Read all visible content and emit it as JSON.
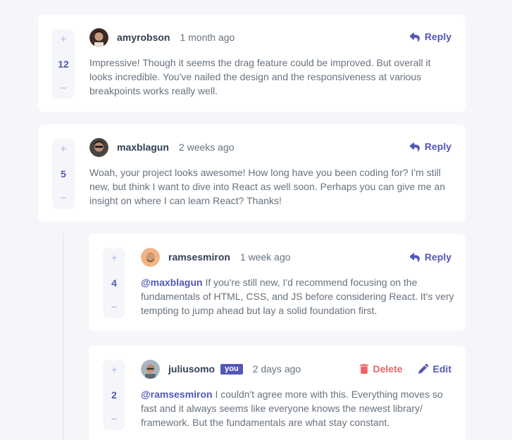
{
  "comments": [
    {
      "score": "12",
      "username": "amyrobson",
      "time": "1 month ago",
      "action": "Reply",
      "text": "Impressive! Though it seems the drag feature could be improved. But overall it looks incredible. You've nailed the design and the responsiveness at various breakpoints works really well."
    },
    {
      "score": "5",
      "username": "maxblagun",
      "time": "2 weeks ago",
      "action": "Reply",
      "text": "Woah, your project looks awesome! How long have you been coding for? I'm still new, but think I want to dive into React as well soon. Perhaps you can give me an insight on where I can learn React? Thanks!"
    }
  ],
  "replies": [
    {
      "score": "4",
      "username": "ramsesmiron",
      "time": "1 week ago",
      "action": "Reply",
      "mention": "@maxblagun",
      "text": " If you're still new, I'd recommend focusing on the fundamentals of HTML, CSS, and JS before considering React. It's very tempting to jump ahead but lay a solid foundation first."
    },
    {
      "score": "2",
      "username": "juliusomo",
      "badge": "you",
      "time": "2 days ago",
      "delete_label": "Delete",
      "edit_label": "Edit",
      "mention": "@ramsesmiron",
      "text": " I couldn't agree more with this. Everything moves so fast and it always seems like everyone knows the newest library/ framework. But the fundamentals are what stay constant."
    }
  ],
  "vote": {
    "plus": "+",
    "minus": "−"
  },
  "colors": {
    "accent": "#5357b6",
    "danger": "#ed6368",
    "background": "#f5f6fa"
  },
  "icons": {
    "reply": "reply-icon",
    "delete": "trash-icon",
    "edit": "pencil-icon"
  }
}
